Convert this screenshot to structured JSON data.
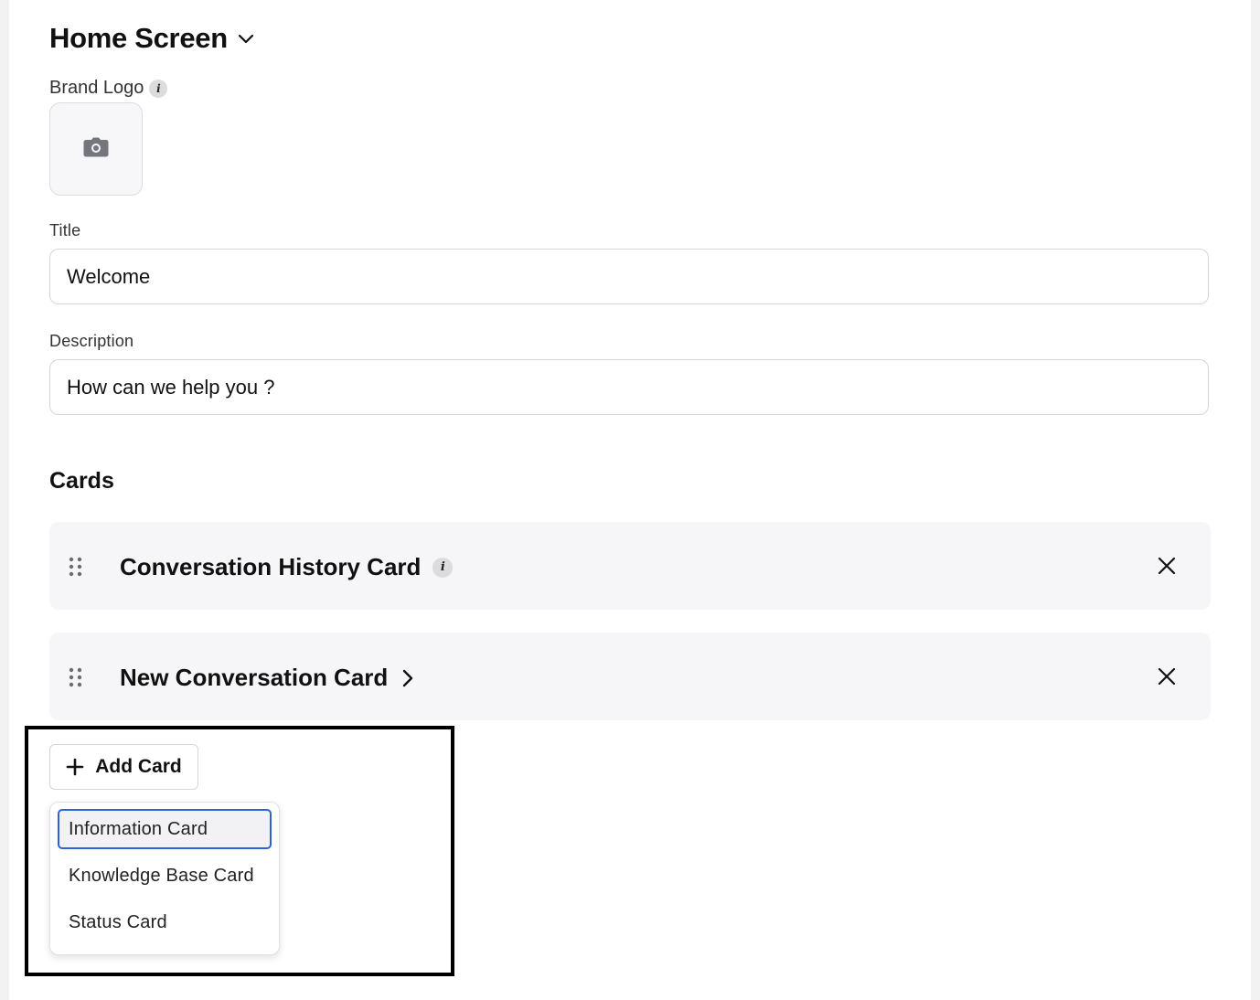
{
  "section": {
    "title": "Home Screen"
  },
  "brand_logo": {
    "label": "Brand Logo",
    "info_icon_text": "i"
  },
  "title_field": {
    "label": "Title",
    "value": "Welcome"
  },
  "description_field": {
    "label": "Description",
    "value": "How can we help you ?"
  },
  "cards": {
    "heading": "Cards",
    "items": [
      {
        "title": "Conversation History Card",
        "trailing_icon": "info-icon"
      },
      {
        "title": "New Conversation Card",
        "trailing_icon": "chevron-right-icon"
      }
    ]
  },
  "add_card": {
    "label": "Add Card",
    "menu": [
      {
        "label": "Information Card",
        "highlighted": true
      },
      {
        "label": "Knowledge Base Card",
        "highlighted": false
      },
      {
        "label": "Status Card",
        "highlighted": false
      }
    ]
  },
  "colors": {
    "focus_border": "#2f62d8",
    "card_background": "#f6f6f8",
    "page_background": "#f2f2f3"
  }
}
